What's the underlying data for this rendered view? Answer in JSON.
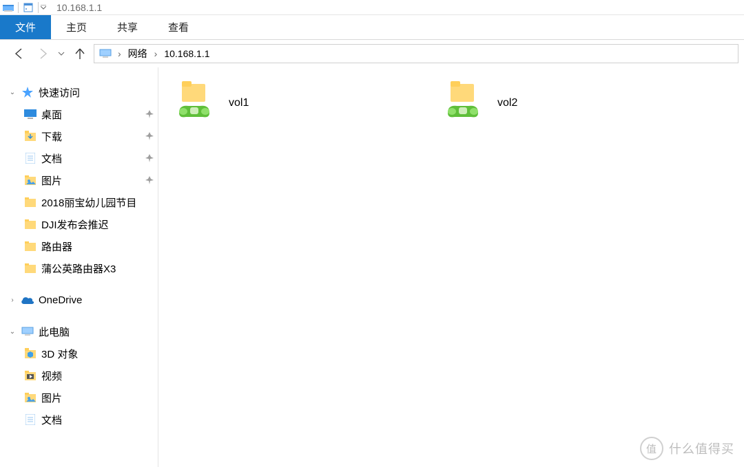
{
  "title": "10.168.1.1",
  "ribbon": {
    "file": "文件",
    "tabs": [
      "主页",
      "共享",
      "查看"
    ]
  },
  "address": {
    "segments": [
      "网络",
      "10.168.1.1"
    ]
  },
  "sidebar": {
    "quick_access": "快速访问",
    "quick_items": [
      {
        "label": "桌面",
        "pinned": true,
        "icon": "desktop"
      },
      {
        "label": "下载",
        "pinned": true,
        "icon": "downloads"
      },
      {
        "label": "文档",
        "pinned": true,
        "icon": "documents"
      },
      {
        "label": "图片",
        "pinned": true,
        "icon": "pictures"
      },
      {
        "label": "2018丽宝幼儿园节目",
        "pinned": false,
        "icon": "folder"
      },
      {
        "label": "DJI发布会推迟",
        "pinned": false,
        "icon": "folder"
      },
      {
        "label": "路由器",
        "pinned": false,
        "icon": "folder"
      },
      {
        "label": "蒲公英路由器X3",
        "pinned": false,
        "icon": "folder"
      }
    ],
    "onedrive": "OneDrive",
    "this_pc": "此电脑",
    "pc_items": [
      {
        "label": "3D 对象",
        "icon": "3d"
      },
      {
        "label": "视频",
        "icon": "videos"
      },
      {
        "label": "图片",
        "icon": "pictures"
      },
      {
        "label": "文档",
        "icon": "documents"
      }
    ]
  },
  "content": {
    "shares": [
      {
        "name": "vol1"
      },
      {
        "name": "vol2"
      }
    ]
  },
  "watermark": "什么值得买"
}
